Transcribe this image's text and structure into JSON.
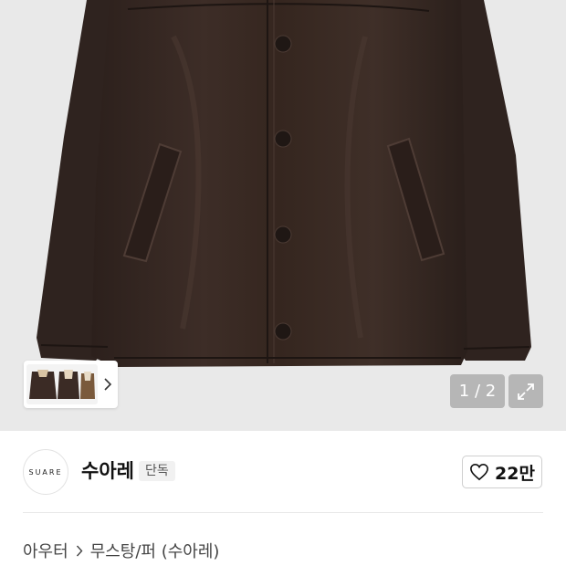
{
  "gallery": {
    "counter": "1 / 2",
    "expand_icon": "expand-icon",
    "next_thumb_icon": "chevron-right-icon"
  },
  "brand": {
    "logo_text": "SUARE",
    "name": "수아레",
    "badge": "단독"
  },
  "like": {
    "icon": "heart-outline-icon",
    "count": "22만"
  },
  "breadcrumb": {
    "level1": "아우터",
    "separator_icon": "chevron-right-icon",
    "level2": "무스탕/퍼 (수아레)"
  },
  "colors": {
    "jacket": "#3a2a24",
    "hero_bg": "#e9e9e9"
  }
}
